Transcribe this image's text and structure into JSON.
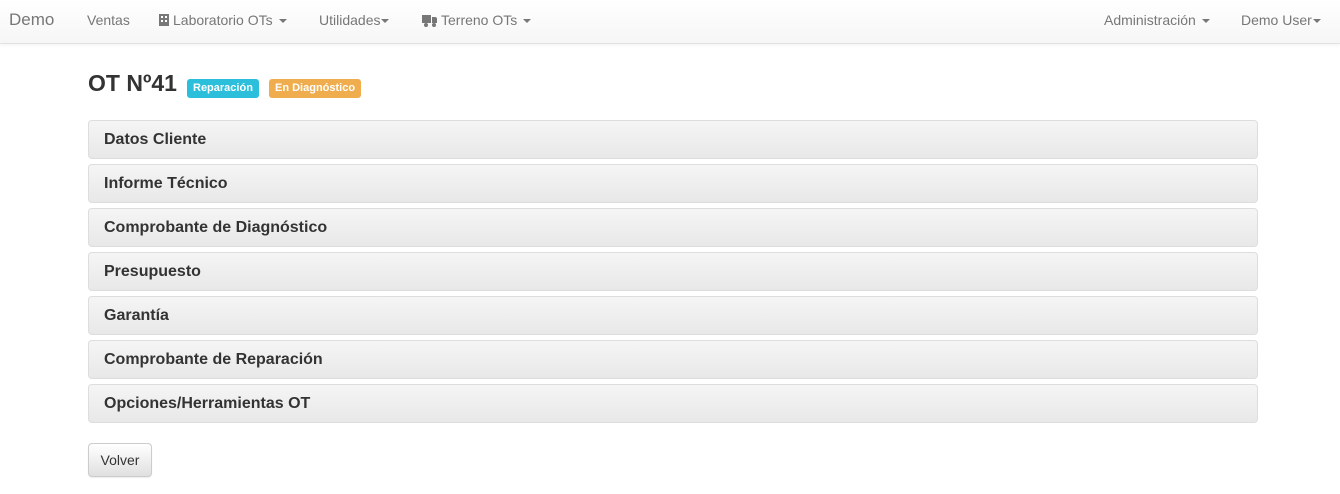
{
  "navbar": {
    "brand": "Demo",
    "items": [
      {
        "label": "Ventas",
        "has_dropdown": false
      },
      {
        "label": "Laboratorio OTs",
        "icon": "building-icon",
        "has_dropdown": true
      },
      {
        "label": "Utilidades",
        "has_dropdown": true
      },
      {
        "label": "Terreno OTs",
        "icon": "truck-icon",
        "has_dropdown": true
      }
    ],
    "right_items": [
      {
        "label": "Administración",
        "has_dropdown": true
      },
      {
        "label": "Demo User",
        "has_dropdown": true
      }
    ]
  },
  "page": {
    "title": "OT Nº41",
    "labels": [
      {
        "text": "Reparación",
        "color": "#2bbfdc"
      },
      {
        "text": "En Diagnóstico",
        "color": "#f0ad4e"
      }
    ]
  },
  "panels": [
    {
      "title": "Datos Cliente"
    },
    {
      "title": "Informe Técnico"
    },
    {
      "title": "Comprobante de Diagnóstico"
    },
    {
      "title": "Presupuesto"
    },
    {
      "title": "Garantía"
    },
    {
      "title": "Comprobante de Reparación"
    },
    {
      "title": "Opciones/Herramientas OT"
    }
  ],
  "actions": {
    "back_label": "Volver"
  },
  "colors": {
    "label_info": "#2bbfdc",
    "label_warning": "#f0ad4e",
    "navbar_text": "#777777"
  }
}
